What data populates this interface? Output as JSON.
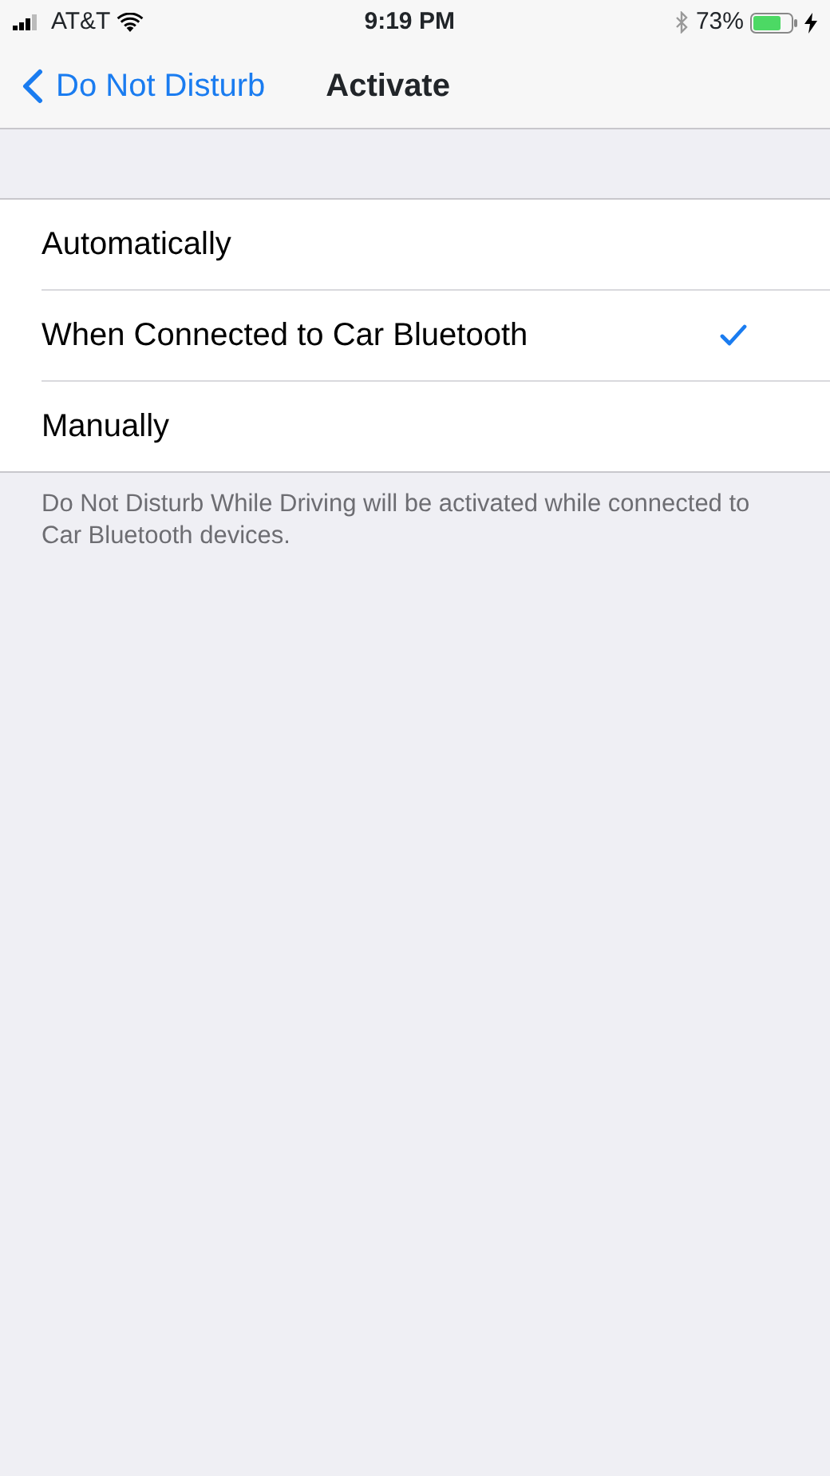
{
  "status_bar": {
    "carrier": "AT&T",
    "time": "9:19 PM",
    "battery_percent": "73%"
  },
  "nav_bar": {
    "back_label": "Do Not Disturb",
    "title": "Activate"
  },
  "options": [
    {
      "label": "Automatically",
      "selected": false
    },
    {
      "label": "When Connected to Car Bluetooth",
      "selected": true
    },
    {
      "label": "Manually",
      "selected": false
    }
  ],
  "footer": "Do Not Disturb While Driving will be activated while connected to Car Bluetooth devices."
}
